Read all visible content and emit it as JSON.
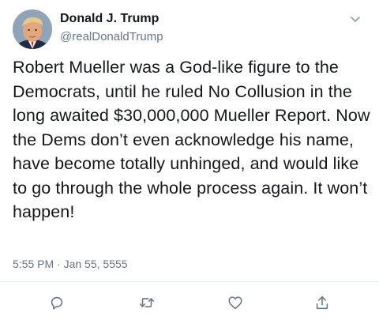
{
  "author": {
    "display_name": "Donald J. Trump",
    "handle": "@realDonaldTrump",
    "avatar_icon": "profile-photo"
  },
  "tweet": {
    "text": "Robert Mueller was a God-like figure to the Democrats, until he ruled No Collusion in the long awaited $30,000,000 Mueller Report. Now the Dems don’t even acknowledge his name, have become totally unhinged, and would like to go through the whole process again. It won’t happen!",
    "time": "5:55 PM",
    "separator": "·",
    "date": "Jan 55, 5555"
  },
  "actions": {
    "reply_icon": "reply-icon",
    "retweet_icon": "retweet-icon",
    "like_icon": "heart-icon",
    "share_icon": "share-icon"
  },
  "colors": {
    "text": "#14171a",
    "secondary": "#657786",
    "divider": "#e6ecf0"
  }
}
